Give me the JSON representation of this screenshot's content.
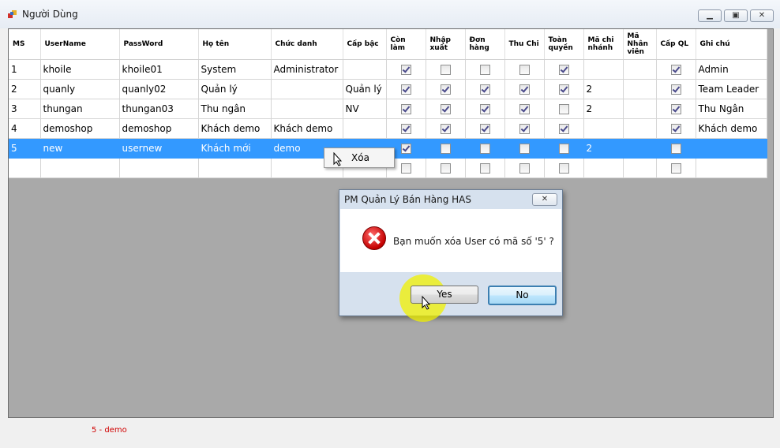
{
  "window": {
    "title": "Người Dùng"
  },
  "table": {
    "columns": [
      "MS",
      "UserName",
      "PassWord",
      "Họ tên",
      "Chức danh",
      "Cấp bậc",
      "Còn làm",
      "Nhập xuất",
      "Đơn hàng",
      "Thu Chi",
      "Toàn quyền",
      "Mã chi nhánh",
      "Mã Nhân viên",
      "Cấp QL",
      "Ghi chú"
    ],
    "rows": [
      {
        "ms": "1",
        "username": "khoile",
        "password": "khoile01",
        "hoten": "System",
        "chucdanh": "Administrator",
        "capbac": "",
        "conlam": true,
        "nhapxuat": false,
        "donhang": false,
        "thuchi": false,
        "toanquyen": true,
        "machinhanh": "",
        "manhanvien": "",
        "capql": true,
        "ghichu": "Admin"
      },
      {
        "ms": "2",
        "username": "quanly",
        "password": "quanly02",
        "hoten": "Quản lý",
        "chucdanh": "",
        "capbac": "Quản lý",
        "conlam": true,
        "nhapxuat": true,
        "donhang": true,
        "thuchi": true,
        "toanquyen": true,
        "machinhanh": "2",
        "manhanvien": "",
        "capql": true,
        "ghichu": "Team Leader"
      },
      {
        "ms": "3",
        "username": "thungan",
        "password": "thungan03",
        "hoten": "Thu ngân",
        "chucdanh": "",
        "capbac": "NV",
        "conlam": true,
        "nhapxuat": true,
        "donhang": true,
        "thuchi": true,
        "toanquyen": false,
        "machinhanh": "2",
        "manhanvien": "",
        "capql": true,
        "ghichu": "Thu Ngân"
      },
      {
        "ms": "4",
        "username": "demoshop",
        "password": "demoshop",
        "hoten": "Khách demo",
        "chucdanh": "Khách demo",
        "capbac": "",
        "conlam": true,
        "nhapxuat": true,
        "donhang": true,
        "thuchi": true,
        "toanquyen": true,
        "machinhanh": "",
        "manhanvien": "",
        "capql": true,
        "ghichu": "Khách demo"
      },
      {
        "ms": "5",
        "username": "new",
        "password": "usernew",
        "hoten": "Khách mới",
        "chucdanh": "demo",
        "capbac": "",
        "conlam": true,
        "nhapxuat": false,
        "donhang": false,
        "thuchi": false,
        "toanquyen": false,
        "machinhanh": "2",
        "manhanvien": "",
        "capql": false,
        "ghichu": "",
        "selected": true
      },
      {
        "ms": "",
        "username": "",
        "password": "",
        "hoten": "",
        "chucdanh": "",
        "capbac": "",
        "conlam": false,
        "nhapxuat": false,
        "donhang": false,
        "thuchi": false,
        "toanquyen": false,
        "machinhanh": "",
        "manhanvien": "",
        "capql": false,
        "ghichu": ""
      }
    ]
  },
  "context_menu": {
    "item": "Xóa"
  },
  "dialog": {
    "title": "PM Quản Lý Bán Hàng HAS",
    "message": "Bạn muốn xóa User có mã số '5' ?",
    "yes_label": "Yes",
    "no_label": "No",
    "icon": "error-icon"
  },
  "status": {
    "text": "5 - demo",
    "color": "#d00000"
  },
  "colors": {
    "selection": "#3399ff",
    "highlight": "#f0f000"
  }
}
